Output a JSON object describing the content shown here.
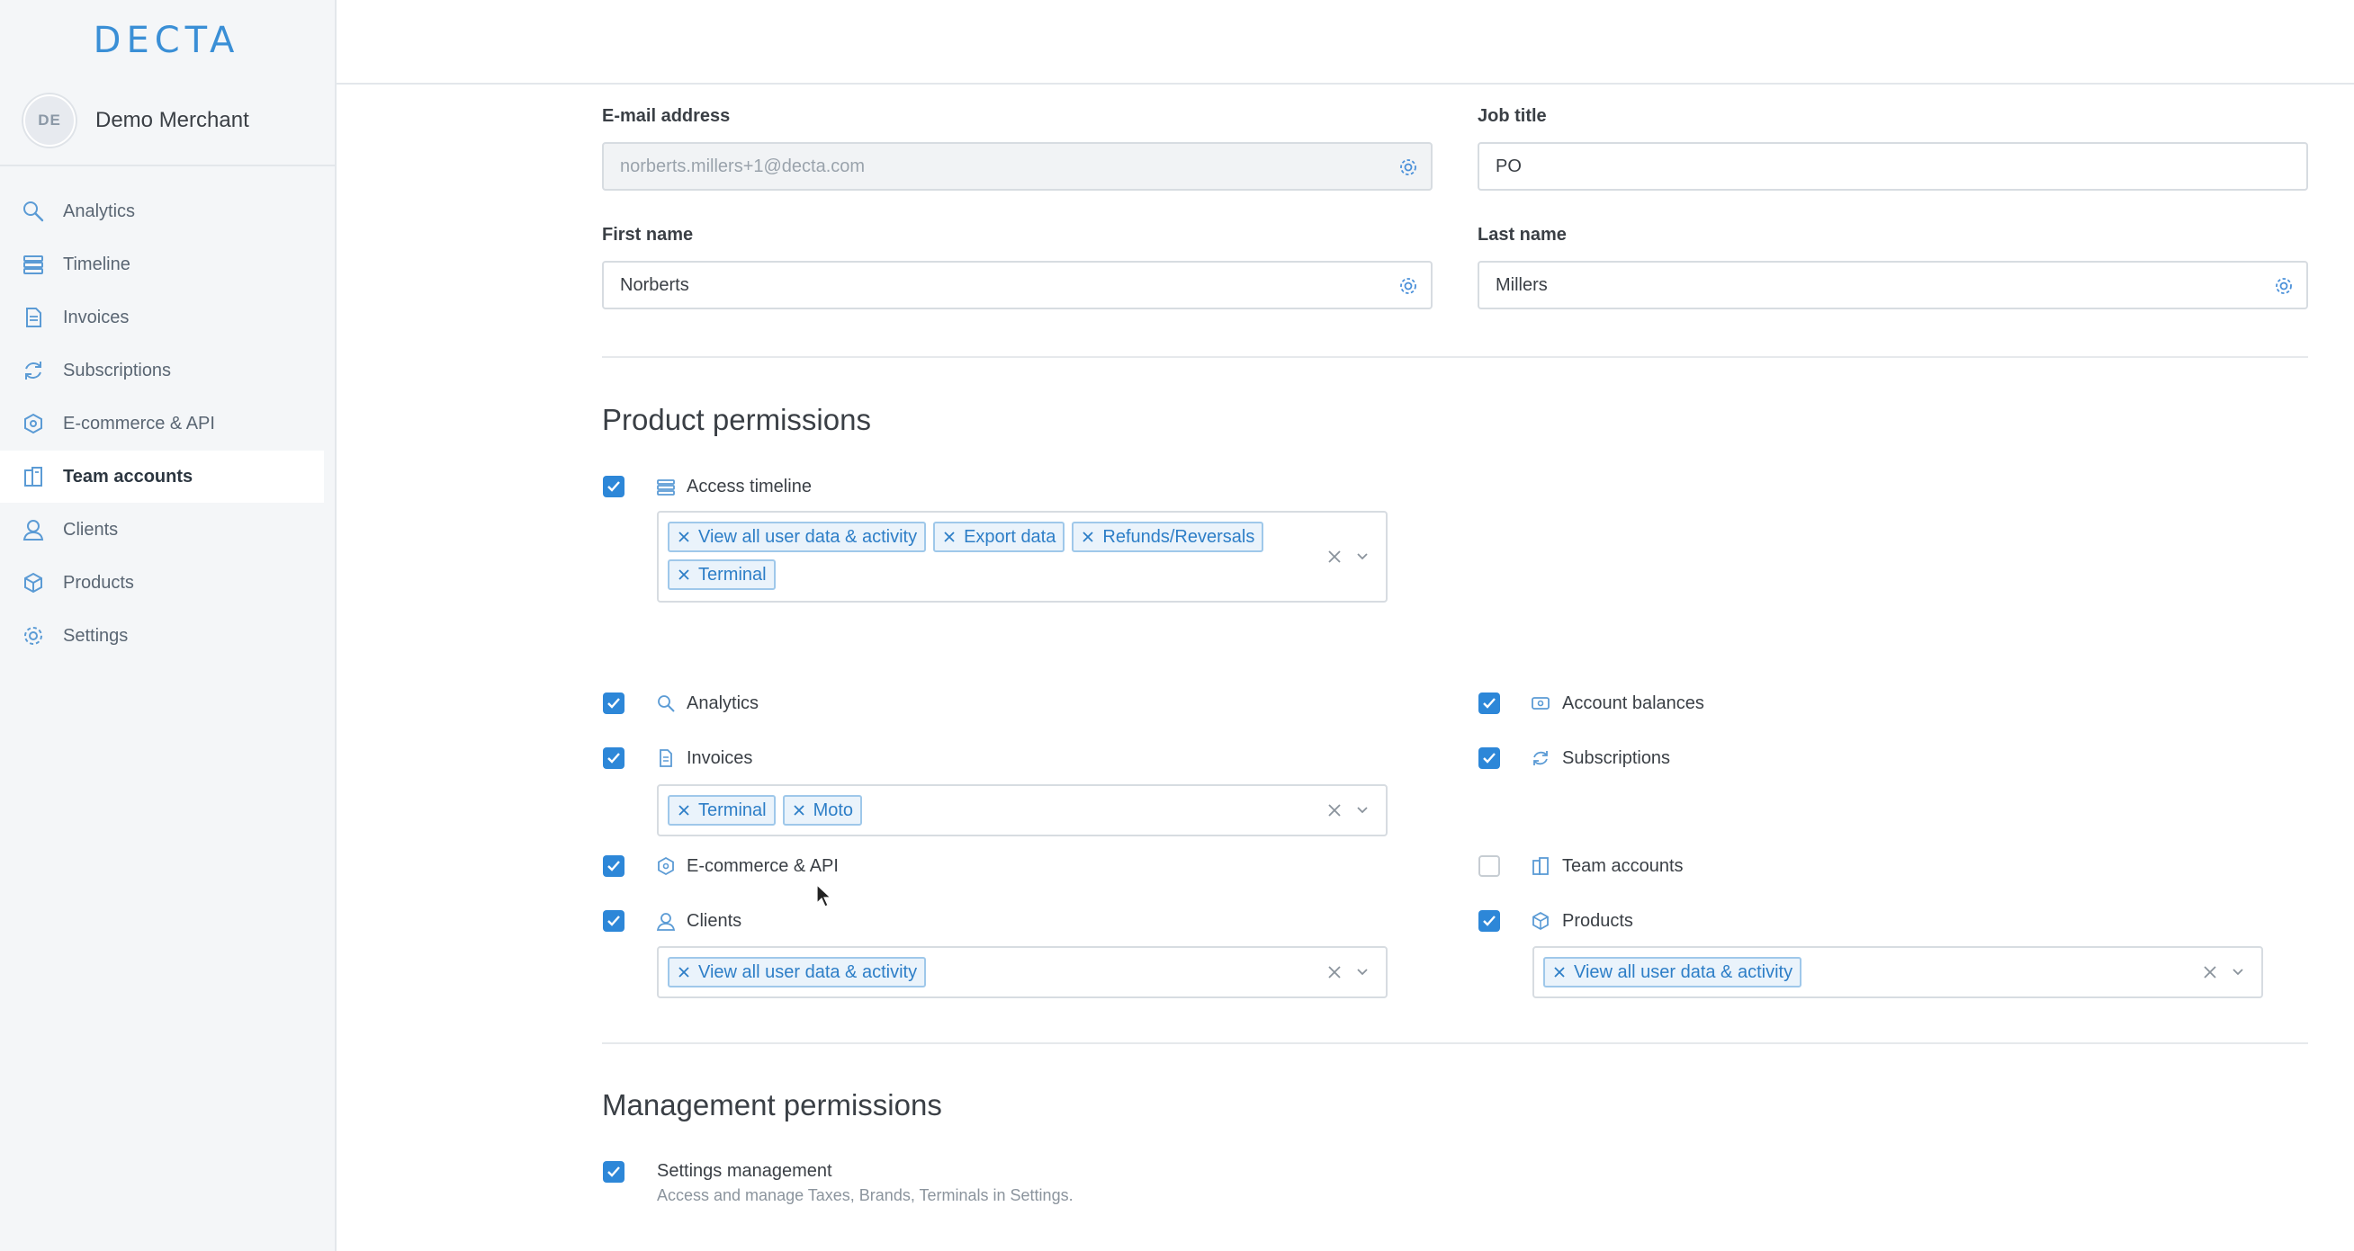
{
  "brand": {
    "logo_text": "DECTA",
    "accent": "#2d87d8",
    "logo_color": "#3a8fd6"
  },
  "merchant": {
    "initials": "DE",
    "name": "Demo Merchant"
  },
  "nav": [
    {
      "label": "Analytics",
      "icon": "search-icon"
    },
    {
      "label": "Timeline",
      "icon": "timeline-icon"
    },
    {
      "label": "Invoices",
      "icon": "document-icon"
    },
    {
      "label": "Subscriptions",
      "icon": "refresh-icon"
    },
    {
      "label": "E-commerce & API",
      "icon": "cube-icon"
    },
    {
      "label": "Team accounts",
      "icon": "team-icon",
      "active": true
    },
    {
      "label": "Clients",
      "icon": "user-icon"
    },
    {
      "label": "Products",
      "icon": "box-icon"
    },
    {
      "label": "Settings",
      "icon": "gear-icon"
    }
  ],
  "form": {
    "email": {
      "label": "E-mail address",
      "value": "norberts.millers+1@decta.com"
    },
    "job_title": {
      "label": "Job title",
      "value": "PO"
    },
    "first_name": {
      "label": "First name",
      "value": "Norberts"
    },
    "last_name": {
      "label": "Last name",
      "value": "Millers"
    }
  },
  "product_permissions": {
    "title": "Product permissions",
    "access_timeline": {
      "label": "Access timeline",
      "checked": true,
      "tags": [
        "View all user data & activity",
        "Export data",
        "Refunds/Reversals",
        "Terminal"
      ]
    },
    "analytics": {
      "label": "Analytics",
      "checked": true
    },
    "account_balances": {
      "label": "Account balances",
      "checked": true
    },
    "invoices": {
      "label": "Invoices",
      "checked": true,
      "tags": [
        "Terminal",
        "Moto"
      ]
    },
    "subscriptions": {
      "label": "Subscriptions",
      "checked": true
    },
    "ecommerce": {
      "label": "E-commerce & API",
      "checked": true
    },
    "team_accounts": {
      "label": "Team accounts",
      "checked": false
    },
    "clients": {
      "label": "Clients",
      "checked": true,
      "tags": [
        "View all user data & activity"
      ]
    },
    "products": {
      "label": "Products",
      "checked": true,
      "tags": [
        "View all user data & activity"
      ]
    }
  },
  "management_permissions": {
    "title": "Management permissions",
    "settings_management": {
      "label": "Settings management",
      "checked": true,
      "description": "Access and manage Taxes, Brands, Terminals in Settings."
    }
  }
}
